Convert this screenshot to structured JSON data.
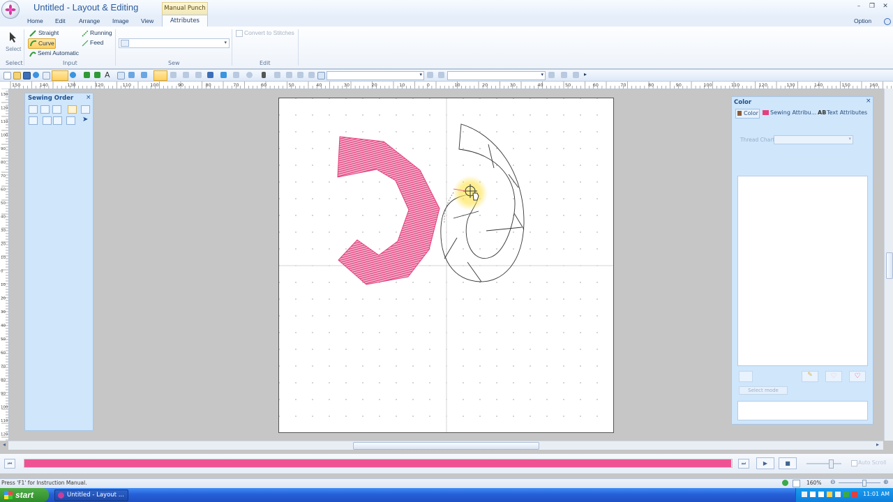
{
  "window": {
    "title": "Untitled - Layout & Editing",
    "context_tab": "Manual Punch",
    "option_label": "Option"
  },
  "menu": {
    "tabs": [
      "Home",
      "Edit",
      "Arrange",
      "Image",
      "View",
      "Attributes"
    ]
  },
  "ribbon": {
    "select_label": "Select",
    "input_items": [
      "Straight",
      "Running",
      "Curve",
      "Feed",
      "Semi Automatic"
    ],
    "convert_label": "Convert to Stitches",
    "groups": [
      "Select",
      "Input",
      "Sew",
      "Edit"
    ]
  },
  "ruler": {
    "top": [
      "150",
      "140",
      "130",
      "120",
      "110",
      "100",
      "90",
      "80",
      "70",
      "60",
      "50",
      "40",
      "30",
      "20",
      "10",
      "0",
      "10",
      "20",
      "30",
      "40",
      "50",
      "60",
      "70",
      "80",
      "90",
      "100",
      "110",
      "120",
      "130",
      "140",
      "150",
      "160"
    ],
    "left": [
      "130",
      "120",
      "110",
      "100",
      "90",
      "80",
      "70",
      "60",
      "50",
      "40",
      "30",
      "20",
      "10",
      "0",
      "10",
      "20",
      "30",
      "40",
      "50",
      "60",
      "70",
      "80",
      "90",
      "100",
      "110",
      "120"
    ]
  },
  "sewing_order": {
    "title": "Sewing Order"
  },
  "color_panel": {
    "title": "Color",
    "tabs": [
      "Color",
      "Sewing Attribu...",
      "Text Attributes"
    ],
    "thread_chart_label": "Thread Chart",
    "mode_button": "Select mode"
  },
  "colors": {
    "stitch": "#e2417d",
    "progress": "#ef5292",
    "panel": "#cfe6fb"
  },
  "playback": {
    "progress": 1.0,
    "autoscroll": "Auto Scroll"
  },
  "status": {
    "hint": "Press 'F1' for Instruction Manual.",
    "zoom": "160%"
  },
  "taskbar": {
    "start": "start",
    "task": "Untitled - Layout ...",
    "clock": "11:01 AM"
  }
}
